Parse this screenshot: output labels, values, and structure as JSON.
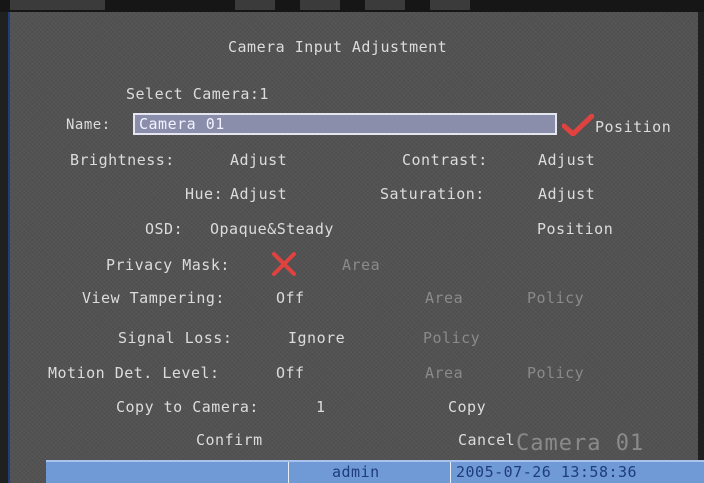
{
  "dialog": {
    "title": "Camera Input Adjustment",
    "select_camera": "Select Camera:1",
    "name_label": "Name:",
    "name_value": "Camera 01",
    "name_position": "Position",
    "brightness_label": "Brightness:",
    "brightness_value": "Adjust",
    "contrast_label": "Contrast:",
    "contrast_value": "Adjust",
    "hue_label": "Hue:",
    "hue_value": "Adjust",
    "saturation_label": "Saturation:",
    "saturation_value": "Adjust",
    "osd_label": "OSD:",
    "osd_value": "Opaque&Steady",
    "osd_position": "Position",
    "privacy_label": "Privacy Mask:",
    "privacy_area": "Area",
    "view_tampering_label": "View Tampering:",
    "view_tampering_value": "Off",
    "view_tampering_area": "Area",
    "view_tampering_policy": "Policy",
    "signal_loss_label": "Signal Loss:",
    "signal_loss_value": "Ignore",
    "signal_loss_policy": "Policy",
    "motion_label": "Motion Det. Level:",
    "motion_value": "Off",
    "motion_area": "Area",
    "motion_policy": "Policy",
    "copy_to_label": "Copy to Camera:",
    "copy_to_value": "1",
    "copy_button": "Copy",
    "confirm_button": "Confirm",
    "cancel_button": "Cancel"
  },
  "overlay": {
    "camera_name": "Camera 01"
  },
  "status_bar": {
    "user": "admin",
    "datetime": "2005-07-26 13:58:36"
  },
  "icons": {
    "name_check": "check-icon",
    "privacy_mask": "x-icon"
  },
  "colors": {
    "accent_red": "#e0423f",
    "status_bar": "#6f9ad6",
    "input_bg": "#8b8eab"
  }
}
